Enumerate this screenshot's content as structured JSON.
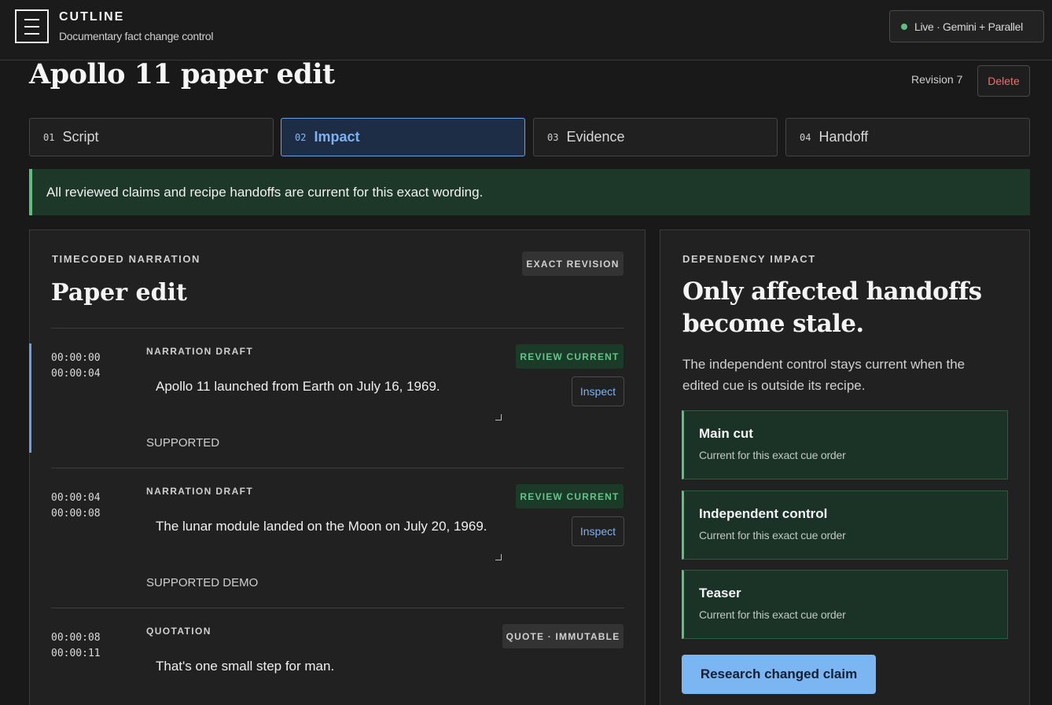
{
  "app": {
    "name": "CUTLINE",
    "subtitle": "Documentary fact change control",
    "status": "Live · Gemini + Parallel",
    "status_color": "#5fbf80"
  },
  "page": {
    "title": "Apollo 11 paper edit",
    "revision": "Revision 7",
    "delete_label": "Delete"
  },
  "tabs": [
    {
      "num": "01",
      "label": "Script",
      "active": false
    },
    {
      "num": "02",
      "label": "Impact",
      "active": true
    },
    {
      "num": "03",
      "label": "Evidence",
      "active": false
    },
    {
      "num": "04",
      "label": "Handoff",
      "active": false
    }
  ],
  "banner": "All reviewed claims and recipe handoffs are current for this exact wording.",
  "narration": {
    "eyebrow": "TIMECODED NARRATION",
    "title": "Paper edit",
    "badge": "EXACT REVISION",
    "segments": [
      {
        "start": "00:00:00",
        "end": "00:00:04",
        "kind": "NARRATION DRAFT",
        "text": "Apollo 11 launched from Earth on July 16, 1969.",
        "badge": "REVIEW CURRENT",
        "action": "Inspect",
        "status": "SUPPORTED"
      },
      {
        "start": "00:00:04",
        "end": "00:00:08",
        "kind": "NARRATION DRAFT",
        "text": "The lunar module landed on the Moon on July 20, 1969.",
        "badge": "REVIEW CURRENT",
        "action": "Inspect",
        "status": "SUPPORTED DEMO"
      },
      {
        "start": "00:00:08",
        "end": "00:00:11",
        "kind": "QUOTATION",
        "text": "That's one small step for man.",
        "badge": "QUOTE · IMMUTABLE"
      }
    ]
  },
  "impact": {
    "eyebrow": "DEPENDENCY IMPACT",
    "title_line1": "Only affected handoffs",
    "title_line2": "become stale.",
    "description": "The independent control stays current when the edited cue is outside its recipe.",
    "cards": [
      {
        "title": "Main cut",
        "subtitle": "Current for this exact cue order"
      },
      {
        "title": "Independent control",
        "subtitle": "Current for this exact cue order"
      },
      {
        "title": "Teaser",
        "subtitle": "Current for this exact cue order"
      }
    ],
    "action": "Research changed claim"
  }
}
